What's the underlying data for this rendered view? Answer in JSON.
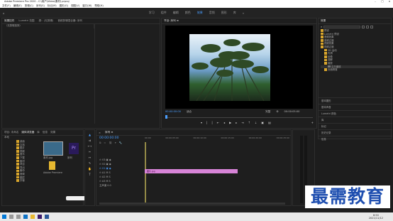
{
  "titlebar": {
    "title": "Adobe Premiere Pro 2020 - C:\\用户\\Video\\素材\\.prproj"
  },
  "menu": [
    "文件(F)",
    "编辑(E)",
    "剪辑(C)",
    "序列(S)",
    "标记(M)",
    "图形(G)",
    "视图(V)",
    "窗口(W)",
    "帮助(H)"
  ],
  "workspaces": [
    {
      "label": "学习",
      "active": false
    },
    {
      "label": "组件",
      "active": false
    },
    {
      "label": "编辑",
      "active": false
    },
    {
      "label": "颜色",
      "active": false
    },
    {
      "label": "效果",
      "active": true
    },
    {
      "label": "音频",
      "active": false
    },
    {
      "label": "图形",
      "active": false
    },
    {
      "label": "库",
      "active": false
    }
  ],
  "source_panel": {
    "tabs": [
      "效果控件",
      "Lumetri 范围",
      "源：(无剪辑)",
      "音频剪辑混合器: 序列"
    ],
    "label": "（无剪辑选择）"
  },
  "program": {
    "tab": "节目: 序列 ≡",
    "timecode_left": "00:00:00:00",
    "fit": "适合",
    "quality": "完整",
    "timecode_right": "00:00:05:00"
  },
  "effects": {
    "title": "效果",
    "search_placeholder": "",
    "tree": [
      {
        "label": "预设",
        "level": 0
      },
      {
        "label": "Lumetri 预设",
        "level": 0
      },
      {
        "label": "音频效果",
        "level": 0
      },
      {
        "label": "音频过渡",
        "level": 0
      },
      {
        "label": "视频效果",
        "level": 0
      },
      {
        "label": "视频过渡",
        "level": 0
      },
      {
        "label": "3D 运动",
        "level": 1
      },
      {
        "label": "内滑",
        "level": 1
      },
      {
        "label": "划像",
        "level": 1
      },
      {
        "label": "溶解",
        "level": 1
      },
      {
        "label": "缩放",
        "level": 1
      },
      {
        "label": "交叉缩放",
        "level": 2,
        "selected": true
      },
      {
        "label": "页面剥落",
        "level": 1
      }
    ],
    "sections": [
      "基本图形",
      "基本声音",
      "Lumetri 颜色",
      "库",
      "标记",
      "历史记录",
      "信息"
    ]
  },
  "project": {
    "tabs": [
      "项目: 未命名",
      "媒体浏览器",
      "库",
      "信息",
      "效果",
      "标记"
    ],
    "drive_label": "本地",
    "folders": [
      "桌面",
      "文档",
      "图片",
      "视频",
      "音乐",
      "下载",
      "素材",
      "项目",
      "导出",
      "备份",
      "音频",
      "图层",
      "字幕"
    ],
    "thumbs": [
      {
        "name": "素材.jpg",
        "dur": "5:00"
      },
      {
        "name": "序列",
        "dur": "5:00"
      },
      {
        "name": "Adobe Premiere",
        "dur": ""
      }
    ]
  },
  "timeline": {
    "tab": "序列 ≡",
    "timecode": "00:00:00:00",
    "ruler": [
      "00:00",
      "00:00:05:00",
      "00:00:10:00",
      "00:00:15:00",
      "00:00:20:00",
      "00:00:25:00"
    ],
    "tracks": [
      "V3",
      "V2",
      "V1",
      "A1",
      "A2",
      "A3"
    ],
    "master": "主声道",
    "master_value": "0.0",
    "clip": "图片.jpg"
  },
  "watermark": "最需教育",
  "taskbar": {
    "time": "8:50",
    "date": "2021/11/12"
  }
}
